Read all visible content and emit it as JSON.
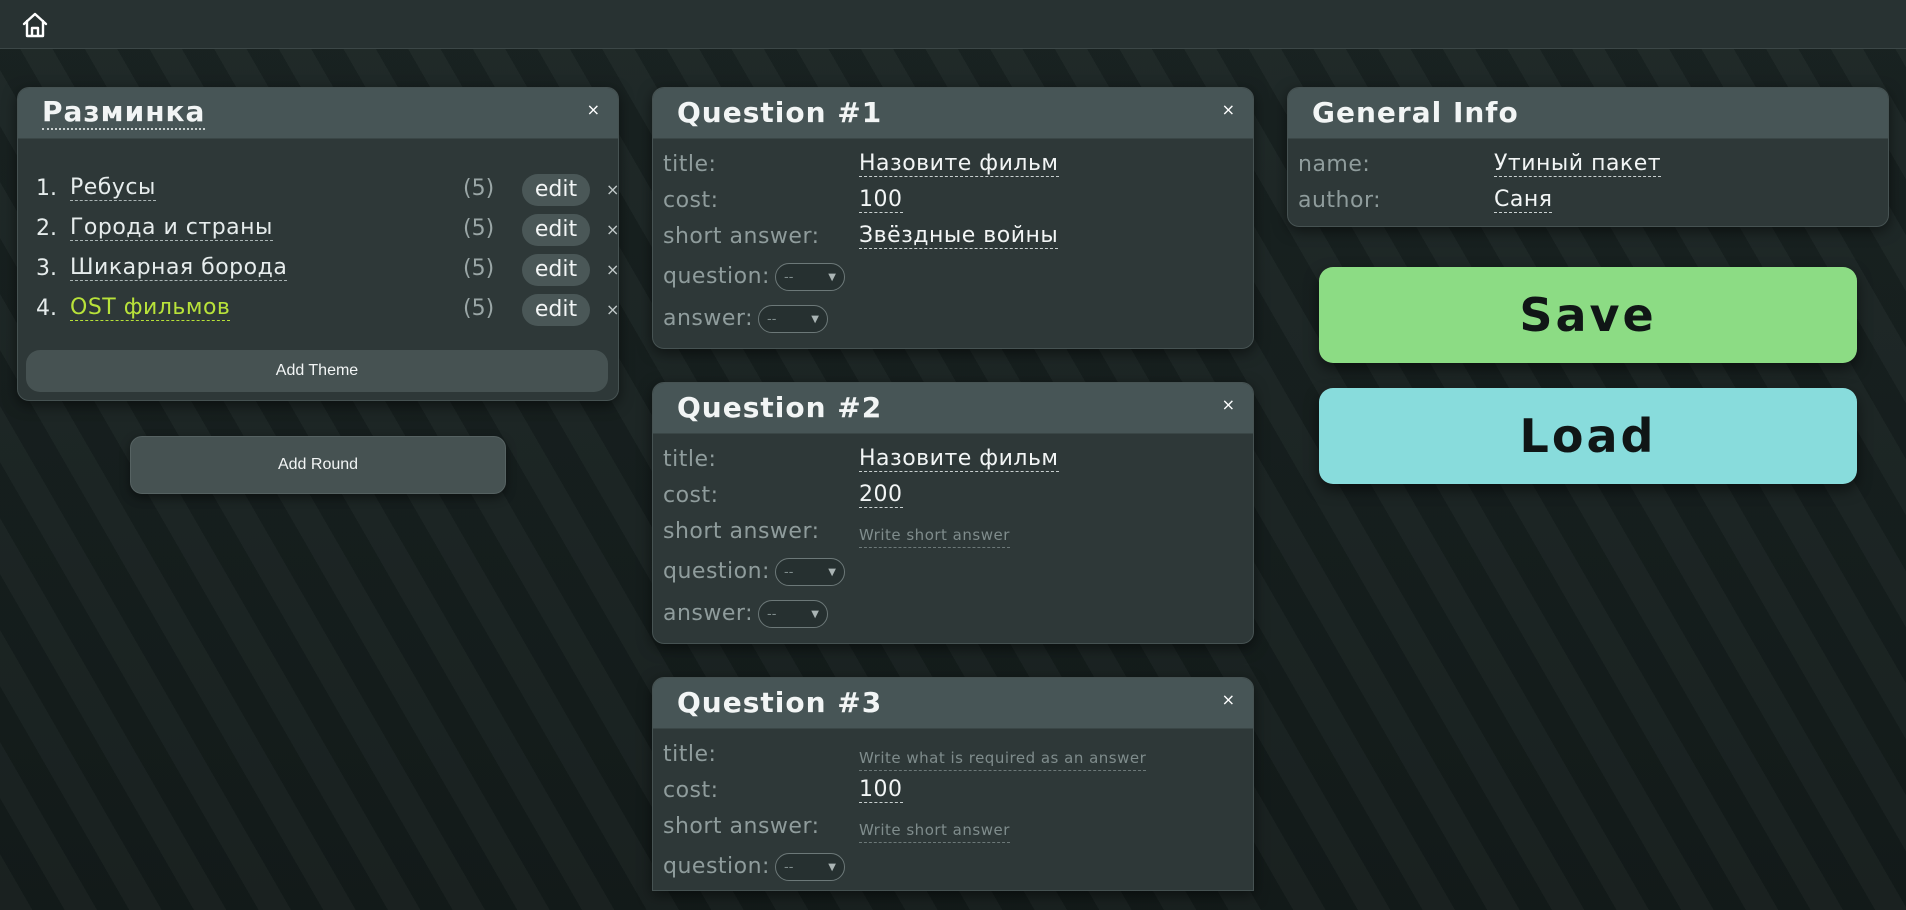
{
  "icons": {
    "home": "home-icon"
  },
  "round": {
    "title": "Разминка",
    "close": "×",
    "themes": [
      {
        "num": "1.",
        "name": "Ребусы",
        "count": "(5)",
        "edit": "edit",
        "close": "×"
      },
      {
        "num": "2.",
        "name": "Города и страны",
        "count": "(5)",
        "edit": "edit",
        "close": "×"
      },
      {
        "num": "3.",
        "name": "Шикарная борода",
        "count": "(5)",
        "edit": "edit",
        "close": "×"
      },
      {
        "num": "4.",
        "name": "OST фильмов",
        "count": "(5)",
        "edit": "edit",
        "close": "×"
      }
    ],
    "add_theme": "Add Theme",
    "add_round": "Add Round"
  },
  "labels": {
    "title": "title:",
    "cost": "cost:",
    "short_answer": "short answer:",
    "question": "question:",
    "answer": "answer:"
  },
  "questions": [
    {
      "header": "Question #1",
      "close": "×",
      "title": "Назовите фильм",
      "cost": "100",
      "short_answer": "Звёздные войны",
      "question_select": "--",
      "answer_select": "--"
    },
    {
      "header": "Question #2",
      "close": "×",
      "title": "Назовите фильм",
      "cost": "200",
      "short_answer_placeholder": "Write short answer",
      "question_select": "--",
      "answer_select": "--"
    },
    {
      "header": "Question #3",
      "close": "×",
      "title_placeholder": "Write what is required as an answer",
      "cost": "100",
      "short_answer_placeholder": "Write short answer",
      "question_select": "--"
    }
  ],
  "general": {
    "header": "General Info",
    "name_label": "name:",
    "name": "Утиный пакет",
    "author_label": "author:",
    "author": "Саня"
  },
  "actions": {
    "save": "Save",
    "load": "Load"
  },
  "colors": {
    "active_theme": "#b8e23a",
    "save": "#8cdc84",
    "load": "#88dcdc"
  }
}
